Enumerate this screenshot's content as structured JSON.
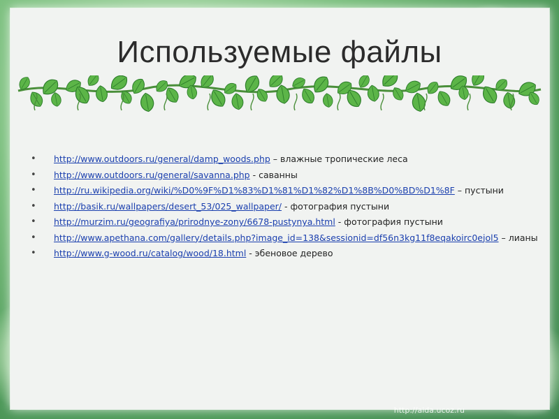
{
  "slide": {
    "title": "Используемые файлы",
    "items": [
      {
        "url": "http://www.outdoors.ru/general/damp_woods.php",
        "desc": " – влажные тропические леса"
      },
      {
        "url": "http://www.outdoors.ru/general/savanna.php",
        "desc": " - саванны"
      },
      {
        "url": "http://ru.wikipedia.org/wiki/%D0%9F%D1%83%D1%81%D1%82%D1%8B%D0%BD%D1%8F",
        "desc": " – пустыни"
      },
      {
        "url": "http://basik.ru/wallpapers/desert_53/025_wallpaper/",
        "desc": " - фотография пустыни"
      },
      {
        "url": "http://murzim.ru/geografiya/prirodnye-zony/6678-pustynya.html",
        "desc": " - фотография пустыни"
      },
      {
        "url": "http://www.apethana.com/gallery/details.php?image_id=138&sessionid=df56n3kg11f8eqakoirc0ejol5",
        "desc": " – лианы"
      },
      {
        "url": "http://www.g-wood.ru/catalog/wood/18.html",
        "desc": " - эбеновое дерево"
      }
    ],
    "watermark": "http://aida.ucoz.ru"
  },
  "colors": {
    "link": "#1a3fae",
    "leaf_dark": "#3f9a3a",
    "leaf_light": "#8fd06f"
  }
}
